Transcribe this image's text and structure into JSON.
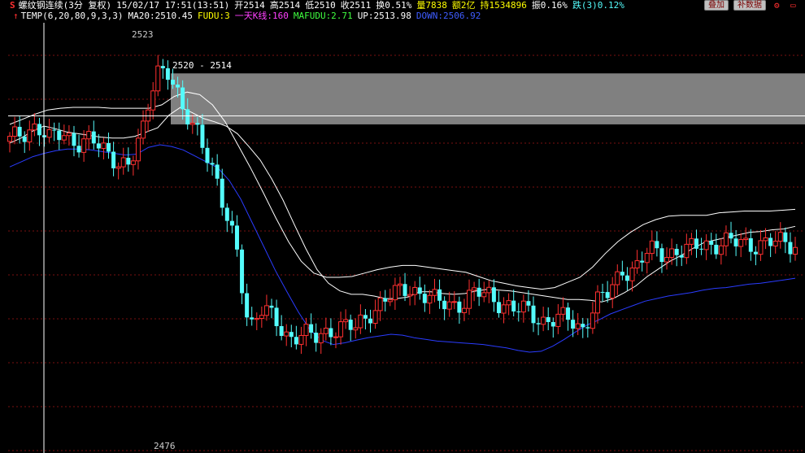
{
  "header": {
    "title": "螺纹钢连续(3分 复权)",
    "datetime": "15/02/17 17:51(13:51)",
    "open": "开2514",
    "high": "高2514",
    "low": "低2510",
    "close": "收2511",
    "turnover": "换0.51%",
    "volume": "量7838",
    "amount": "额2亿",
    "open_interest": "持1534896",
    "amplitude": "振0.16%",
    "change": "跌(3)0.12%"
  },
  "buttons": {
    "compare": "叠加",
    "f10": "补数据"
  },
  "indicators": {
    "temp": "TEMP(6,20,80,9,3,3)",
    "ma20": "MA20:2510.45",
    "fudu": "FUDU:3",
    "day_k": "一天K线:160",
    "mafudu": "MAFUDU:2.71",
    "up": "UP:2513.98",
    "down": "DOWN:2506.92"
  },
  "colors": {
    "up_candle": "#ff3030",
    "down_candle": "#54fcfc",
    "ma20": "#ffffff",
    "upper_band": "#ffffff",
    "lower_band": "#2a3cff",
    "zone": "#808080",
    "grid": "#7a1010",
    "fudu": "#ffff00",
    "day_k": "#ff40ff",
    "mafudu": "#40ff40",
    "up_line": "#ffffff",
    "down_line": "#3e5cff",
    "hl_label": "#cccccc"
  },
  "icons": {
    "s": "s-icon",
    "arrow": "up-arrow-icon",
    "settings": "settings-icon",
    "minimize": "minimize-icon"
  },
  "chart_data": {
    "type": "candlestick",
    "title": "螺纹钢连续(3分 复权)",
    "ylim": [
      2476,
      2525
    ],
    "high_label": "2523",
    "low_label": "2476",
    "zone": {
      "top": 2520,
      "bottom": 2514,
      "label": "2520 - 2514"
    },
    "crosshair_y": 2515,
    "series": [
      {
        "name": "MA20",
        "values": [
          2511.8,
          2512.4,
          2513.2,
          2513.8,
          2513.5,
          2513.1,
          2512.9,
          2512.7,
          2512.5,
          2512.4,
          2512.4,
          2512.6,
          2513.1,
          2513.6,
          2515.1,
          2516.0,
          2515.4,
          2514.7,
          2514.3,
          2513.8,
          2512.9,
          2511.4,
          2509.8,
          2507.6,
          2505.1,
          2502.2,
          2499.4,
          2496.9,
          2495.3,
          2494.4,
          2494.0,
          2494.0,
          2493.8,
          2493.5,
          2493.5,
          2493.7,
          2494.3,
          2494.3,
          2494.1,
          2494.0,
          2494.1,
          2494.4,
          2494.6,
          2494.5,
          2494.4,
          2494.2,
          2494.0,
          2493.8,
          2493.6,
          2493.4,
          2493.4,
          2493.3,
          2493.1,
          2493.5,
          2494.2,
          2495.0,
          2496.1,
          2497.0,
          2497.9,
          2498.6,
          2499.4,
          2500.1,
          2500.4,
          2500.7,
          2501.0,
          2501.3,
          2501.4,
          2501.6,
          2501.7,
          2502.0
        ]
      },
      {
        "name": "UP",
        "values": [
          2514.0,
          2514.6,
          2515.2,
          2515.7,
          2515.9,
          2516.0,
          2516.0,
          2516.0,
          2515.9,
          2515.9,
          2515.9,
          2515.9,
          2516.3,
          2517.3,
          2517.8,
          2517.5,
          2516.3,
          2514.3,
          2511.6,
          2508.9,
          2506.0,
          2503.0,
          2500.2,
          2497.9,
          2496.5,
          2496.0,
          2496.0,
          2496.1,
          2496.5,
          2496.9,
          2497.2,
          2497.4,
          2497.4,
          2497.2,
          2497.0,
          2496.8,
          2496.6,
          2496.1,
          2495.6,
          2495.3,
          2495.0,
          2494.8,
          2494.6,
          2494.8,
          2495.4,
          2496.0,
          2497.2,
          2498.8,
          2500.2,
          2501.3,
          2502.2,
          2502.8,
          2503.2,
          2503.3,
          2503.3,
          2503.3,
          2503.6,
          2503.7,
          2503.8,
          2503.8,
          2503.8,
          2503.9,
          2504.0
        ]
      },
      {
        "name": "DOWN",
        "values": [
          2509.0,
          2509.6,
          2510.2,
          2510.6,
          2510.9,
          2511.1,
          2511.1,
          2511.0,
          2510.8,
          2510.6,
          2510.4,
          2510.5,
          2511.3,
          2511.6,
          2511.4,
          2511.0,
          2510.3,
          2509.6,
          2508.9,
          2507.4,
          2505.2,
          2502.4,
          2499.6,
          2496.8,
          2494.3,
          2491.9,
          2489.8,
          2488.6,
          2488.1,
          2488.3,
          2488.6,
          2488.9,
          2489.1,
          2489.3,
          2489.2,
          2488.9,
          2488.7,
          2488.5,
          2488.4,
          2488.3,
          2488.2,
          2488.1,
          2487.9,
          2487.7,
          2487.4,
          2487.2,
          2487.3,
          2487.9,
          2488.7,
          2489.6,
          2490.4,
          2491.0,
          2491.7,
          2492.2,
          2492.7,
          2493.2,
          2493.5,
          2493.8,
          2494.0,
          2494.2,
          2494.5,
          2494.7,
          2494.8,
          2495.0,
          2495.2,
          2495.3,
          2495.5,
          2495.7,
          2495.9
        ]
      },
      {
        "name": "Price",
        "values": [
          2512,
          2513,
          2514,
          2512,
          2513,
          2512,
          2512,
          2511,
          2510,
          2509,
          2513,
          2521,
          2520,
          2515,
          2514,
          2510,
          2504,
          2500,
          2490,
          2492,
          2491,
          2489,
          2489,
          2489,
          2490,
          2490,
          2490,
          2492,
          2493,
          2494,
          2495,
          2494,
          2493,
          2493,
          2493,
          2494,
          2494,
          2493,
          2492,
          2492,
          2491,
          2491,
          2491,
          2490,
          2493,
          2494,
          2497,
          2497,
          2499,
          2499,
          2499,
          2499,
          2500,
          2500,
          2500,
          2500,
          2500,
          2500,
          2500,
          2500
        ]
      }
    ]
  }
}
